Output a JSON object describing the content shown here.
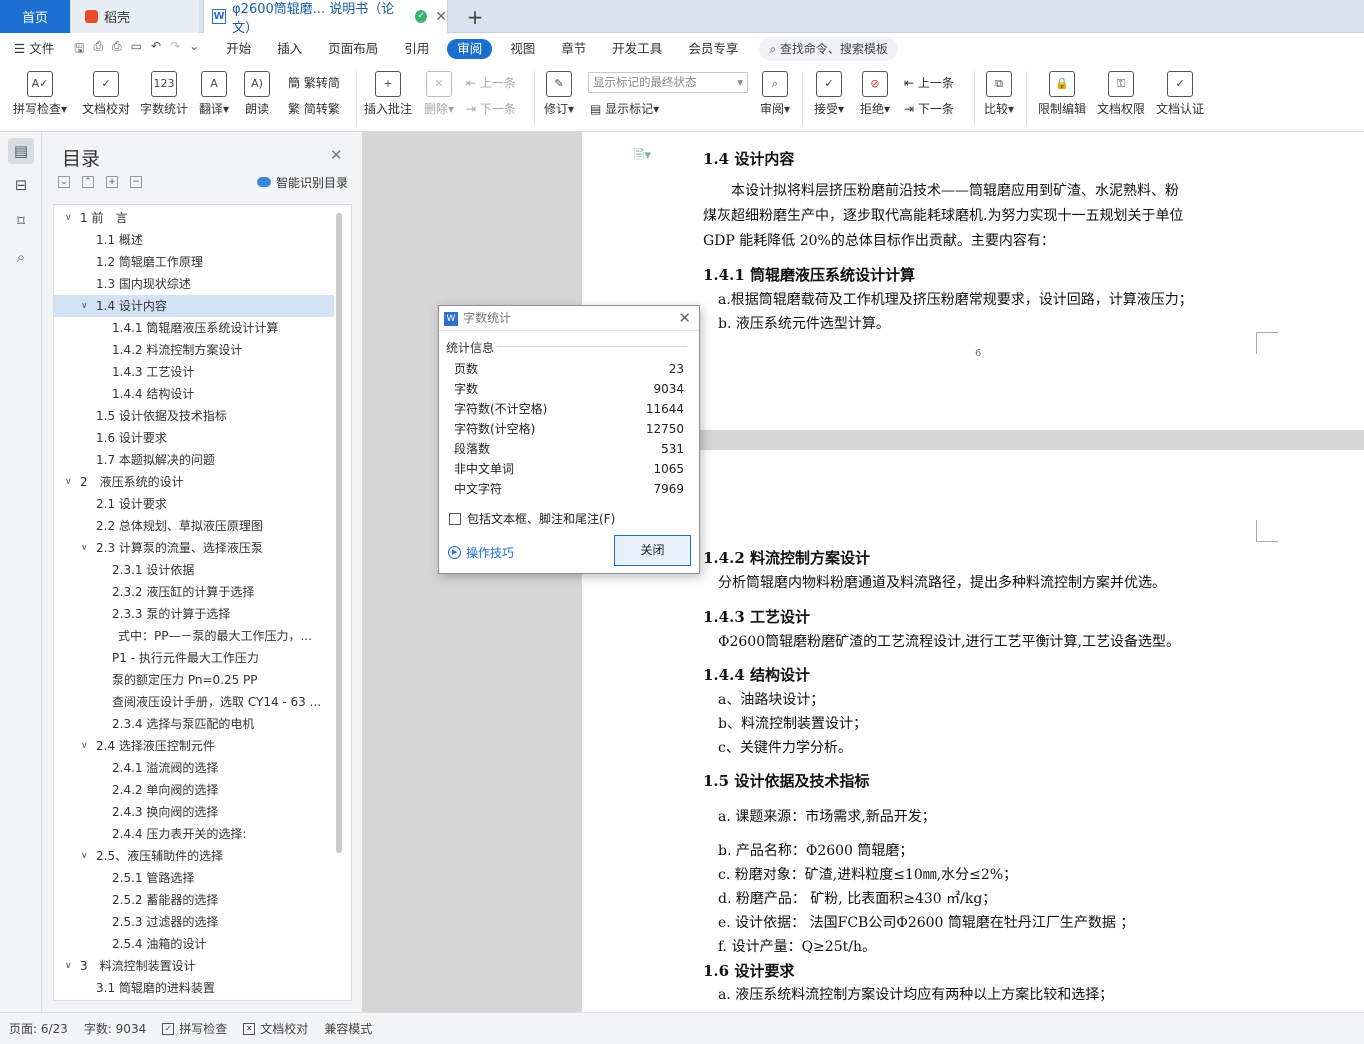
{
  "tabs": {
    "home": "首页",
    "daoke": "稻壳",
    "document": "φ2600筒辊磨... 说明书（论文）"
  },
  "menubar": {
    "file": "文件",
    "items": [
      "开始",
      "插入",
      "页面布局",
      "引用",
      "审阅",
      "视图",
      "章节",
      "开发工具",
      "会员专享"
    ],
    "active": "审阅",
    "search_placeholder": "查找命令、搜索模板"
  },
  "ribbon": {
    "spellcheck": "拼写检查",
    "doc_proof": "文档校对",
    "word_count": "字数统计",
    "translate": "翻译",
    "read_aloud": "朗读",
    "to_traditional": "繁转简",
    "to_simplified": "简转繁",
    "insert_comment": "插入批注",
    "delete": "删除",
    "prev_comment": "上一条",
    "next_comment": "下一条",
    "track": "修订",
    "markup_select": "显示标记的最终状态",
    "show_markup": "显示标记",
    "review": "审阅",
    "accept": "接受",
    "reject": "拒绝",
    "prev_change": "上一条",
    "next_change": "下一条",
    "compare": "比较",
    "restrict": "限制编辑",
    "doc_rights": "文档权限",
    "doc_cert": "文档认证"
  },
  "toc": {
    "title": "目录",
    "smart": "智能识别目录",
    "items": [
      {
        "text": "1 前　言",
        "level": 0,
        "caret": "open"
      },
      {
        "text": "1.1  概述",
        "level": 1
      },
      {
        "text": "1.2  筒辊磨工作原理",
        "level": 1
      },
      {
        "text": "1.3  国内现状综述",
        "level": 1
      },
      {
        "text": "1.4  设计内容",
        "level": 1,
        "caret": "open",
        "selected": true
      },
      {
        "text": "1.4.1  筒辊磨液压系统设计计算",
        "level": 2
      },
      {
        "text": "1.4.2  料流控制方案设计",
        "level": 2
      },
      {
        "text": "1.4.3  工艺设计",
        "level": 2
      },
      {
        "text": "1.4.4  结构设计",
        "level": 2
      },
      {
        "text": "1.5  设计依据及技术指标",
        "level": 1
      },
      {
        "text": "1.6  设计要求",
        "level": 1
      },
      {
        "text": "1.7  本题拟解决的问题",
        "level": 1
      },
      {
        "text": "2　液压系统的设计",
        "level": 0,
        "caret": "open"
      },
      {
        "text": "2.1  设计要求",
        "level": 1
      },
      {
        "text": "2.2  总体规划、草拟液压原理图",
        "level": 1
      },
      {
        "text": "2.3  计算泵的流量、选择液压泵",
        "level": 1,
        "caret": "open"
      },
      {
        "text": "2.3.1  设计依据",
        "level": 2
      },
      {
        "text": "2.3.2  液压缸的计算于选择",
        "level": 2
      },
      {
        "text": "2.3.3  泵的计算于选择",
        "level": 2
      },
      {
        "text": "式中：PP—－泵的最大工作压力，...",
        "level": 3
      },
      {
        "text": "P1 - 执行元件最大工作压力",
        "level": 2
      },
      {
        "text": "泵的额定压力 Pn=0.25 PP",
        "level": 2
      },
      {
        "text": "查阅液压设计手册，选取 CY14 - 63 ...",
        "level": 2
      },
      {
        "text": "2.3.4  选择与泵匹配的电机",
        "level": 2
      },
      {
        "text": "2.4  选择液压控制元件",
        "level": 1,
        "caret": "open"
      },
      {
        "text": "2.4.1  溢流阀的选择",
        "level": 2
      },
      {
        "text": "2.4.2  单向阀的选择",
        "level": 2
      },
      {
        "text": "2.4.3  换向阀的选择",
        "level": 2
      },
      {
        "text": "2.4.4  压力表开关的选择:",
        "level": 2
      },
      {
        "text": "2.5、液压辅助件的选择",
        "level": 1,
        "caret": "open"
      },
      {
        "text": "2.5.1  管路选择",
        "level": 2
      },
      {
        "text": "2.5.2  蓄能器的选择",
        "level": 2
      },
      {
        "text": "2.5.3  过滤器的选择",
        "level": 2
      },
      {
        "text": "2.5.4  油箱的设计",
        "level": 2
      },
      {
        "text": "3　料流控制装置设计",
        "level": 0,
        "caret": "open"
      },
      {
        "text": "3.1  筒辊磨的进料装置",
        "level": 1
      }
    ]
  },
  "doc": {
    "p1_h14": "1.4 设计内容",
    "p1_para1": "本设计拟将料层挤压粉磨前沿技术——筒辊磨应用到矿渣、水泥熟料、粉",
    "p1_para2": "煤灰超细粉磨生产中，逐步取代高能耗球磨机.为努力实现十一五规划关于单位",
    "p1_para3": "GDP 能耗降低 20%的总体目标作出贡献。主要内容有：",
    "p1_h141": "1.4.1 筒辊磨液压系统设计计算",
    "p1_item_a": "a.根据筒辊磨载荷及工作机理及挤压粉磨常规要求，设计回路，计算液压力；",
    "p1_item_b": "b. 液压系统元件选型计算。",
    "page_number": "6",
    "p2_h142": "1.4.2 料流控制方案设计",
    "p2_142_text": "分析筒辊磨内物料粉磨通道及料流路径，提出多种料流控制方案并优选。",
    "p2_h143": "1.4.3 工艺设计",
    "p2_143_text": "Φ2600筒辊磨粉磨矿渣的工艺流程设计,进行工艺平衡计算,工艺设备选型。",
    "p2_h144": "1.4.4 结构设计",
    "p2_144_a": "a、油路块设计；",
    "p2_144_b": "b、料流控制装置设计；",
    "p2_144_c": "c、关键件力学分析。",
    "p2_h15": "1.5 设计依据及技术指标",
    "p2_15_a": "a. 课题来源：市场需求,新品开发；",
    "p2_15_b": "b. 产品名称：Φ2600 筒辊磨；",
    "p2_15_c": "c. 粉磨对象：矿渣,进料粒度≤10㎜,水分≤2%；",
    "p2_15_d": "d. 粉磨产品： 矿粉, 比表面积≥430 ㎡/kg；",
    "p2_15_e": "e. 设计依据： 法国FCB公司Φ2600 筒辊磨在牡丹江厂生产数据 ；",
    "p2_15_f": "f. 设计产量：Q≥25t/h。",
    "p2_h16": "1.6 设计要求",
    "p2_16_a": "a. 液压系统料流控制方案设计均应有两种以上方案比较和选择；"
  },
  "dialog": {
    "title": "字数统计",
    "section": "统计信息",
    "stats": [
      {
        "label": "页数",
        "value": "23"
      },
      {
        "label": "字数",
        "value": "9034"
      },
      {
        "label": "字符数(不计空格)",
        "value": "11644"
      },
      {
        "label": "字符数(计空格)",
        "value": "12750"
      },
      {
        "label": "段落数",
        "value": "531"
      },
      {
        "label": "非中文单词",
        "value": "1065"
      },
      {
        "label": "中文字符",
        "value": "7969"
      }
    ],
    "include_label": "包括文本框、脚注和尾注(F)",
    "include_checked": false,
    "tips": "操作技巧",
    "close": "关闭"
  },
  "status": {
    "page": "页面: 6/23",
    "words": "字数: 9034",
    "spell": "拼写检查",
    "proof": "文档校对",
    "compat": "兼容模式"
  }
}
